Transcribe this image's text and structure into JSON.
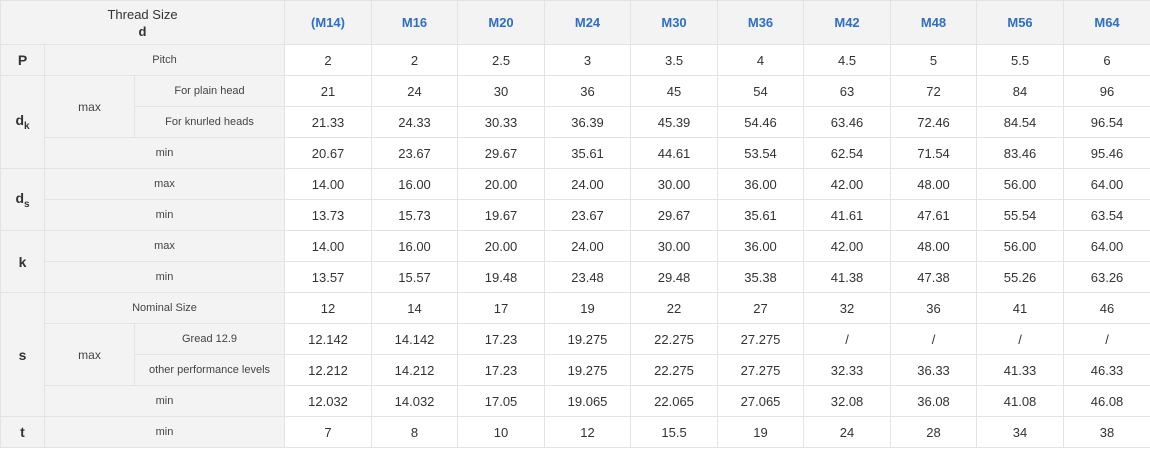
{
  "header": {
    "corner_title": "Thread Size",
    "corner_sub": "d",
    "columns": [
      "(M14)",
      "M16",
      "M20",
      "M24",
      "M30",
      "M36",
      "M42",
      "M48",
      "M56",
      "M64"
    ]
  },
  "symbols": {
    "P": "P",
    "dk_main": "d",
    "dk_sub": "k",
    "ds_main": "d",
    "ds_sub": "s",
    "k": "k",
    "s": "s",
    "t": "t"
  },
  "labels": {
    "pitch": "Pitch",
    "max": "max",
    "min": "min",
    "for_plain_head": "For plain head",
    "for_knurled_heads": "For knurled heads",
    "nominal_size": "Nominal Size",
    "gread_12_9": "Gread 12.9",
    "other_performance_levels": "other performance levels"
  },
  "rows": {
    "pitch": [
      "2",
      "2",
      "2.5",
      "3",
      "3.5",
      "4",
      "4.5",
      "5",
      "5.5",
      "6"
    ],
    "dk_max_plain": [
      "21",
      "24",
      "30",
      "36",
      "45",
      "54",
      "63",
      "72",
      "84",
      "96"
    ],
    "dk_max_knurled": [
      "21.33",
      "24.33",
      "30.33",
      "36.39",
      "45.39",
      "54.46",
      "63.46",
      "72.46",
      "84.54",
      "96.54"
    ],
    "dk_min": [
      "20.67",
      "23.67",
      "29.67",
      "35.61",
      "44.61",
      "53.54",
      "62.54",
      "71.54",
      "83.46",
      "95.46"
    ],
    "ds_max": [
      "14.00",
      "16.00",
      "20.00",
      "24.00",
      "30.00",
      "36.00",
      "42.00",
      "48.00",
      "56.00",
      "64.00"
    ],
    "ds_min": [
      "13.73",
      "15.73",
      "19.67",
      "23.67",
      "29.67",
      "35.61",
      "41.61",
      "47.61",
      "55.54",
      "63.54"
    ],
    "k_max": [
      "14.00",
      "16.00",
      "20.00",
      "24.00",
      "30.00",
      "36.00",
      "42.00",
      "48.00",
      "56.00",
      "64.00"
    ],
    "k_min": [
      "13.57",
      "15.57",
      "19.48",
      "23.48",
      "29.48",
      "35.38",
      "41.38",
      "47.38",
      "55.26",
      "63.26"
    ],
    "s_nominal": [
      "12",
      "14",
      "17",
      "19",
      "22",
      "27",
      "32",
      "36",
      "41",
      "46"
    ],
    "s_max_gread": [
      "12.142",
      "14.142",
      "17.23",
      "19.275",
      "22.275",
      "27.275",
      "/",
      "/",
      "/",
      "/"
    ],
    "s_max_other": [
      "12.212",
      "14.212",
      "17.23",
      "19.275",
      "22.275",
      "27.275",
      "32.33",
      "36.33",
      "41.33",
      "46.33"
    ],
    "s_min": [
      "12.032",
      "14.032",
      "17.05",
      "19.065",
      "22.065",
      "27.065",
      "32.08",
      "36.08",
      "41.08",
      "46.08"
    ],
    "t_min": [
      "7",
      "8",
      "10",
      "12",
      "15.5",
      "19",
      "24",
      "28",
      "34",
      "38"
    ]
  }
}
